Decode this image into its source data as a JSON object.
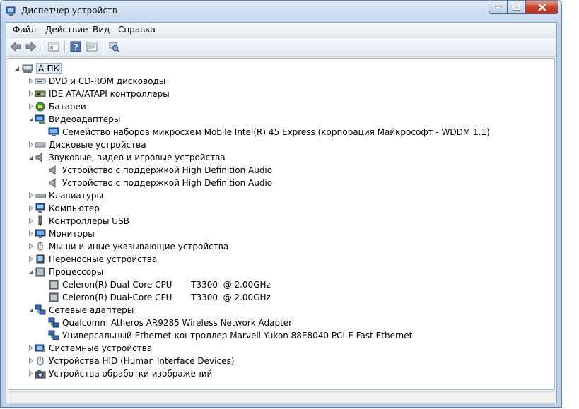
{
  "window": {
    "title": "Диспетчер устройств"
  },
  "menu": [
    "Файл",
    "Действие",
    "Вид",
    "Справка"
  ],
  "toolbar": {
    "buttons": [
      "back-icon",
      "forward-icon",
      "show-hide-tree-icon",
      "help-icon",
      "properties-icon",
      "scan-hardware-icon"
    ]
  },
  "tree": {
    "root": "А-ПК",
    "categories": [
      {
        "label": "DVD и CD-ROM дисководы",
        "icon": "dvd-drive-icon",
        "expanded": false,
        "children": []
      },
      {
        "label": "IDE ATA/ATAPI контроллеры",
        "icon": "ide-controller-icon",
        "expanded": false,
        "children": []
      },
      {
        "label": "Батареи",
        "icon": "battery-icon",
        "expanded": false,
        "children": []
      },
      {
        "label": "Видеоадаптеры",
        "icon": "display-adapter-icon",
        "expanded": true,
        "children": [
          "Семейство наборов микросхем Mobile Intel(R) 45 Express (корпорация Майкрософт - WDDM 1.1)"
        ]
      },
      {
        "label": "Дисковые устройства",
        "icon": "disk-drive-icon",
        "expanded": false,
        "children": []
      },
      {
        "label": "Звуковые, видео и игровые устройства",
        "icon": "speaker-icon",
        "expanded": true,
        "children": [
          "Устройство с поддержкой High Definition Audio",
          "Устройство с поддержкой High Definition Audio"
        ]
      },
      {
        "label": "Клавиатуры",
        "icon": "keyboard-icon",
        "expanded": false,
        "children": []
      },
      {
        "label": "Компьютер",
        "icon": "computer-icon",
        "expanded": false,
        "children": []
      },
      {
        "label": "Контроллеры USB",
        "icon": "usb-icon",
        "expanded": false,
        "children": []
      },
      {
        "label": "Мониторы",
        "icon": "monitor-icon",
        "expanded": false,
        "children": []
      },
      {
        "label": "Мыши и иные указывающие устройства",
        "icon": "mouse-icon",
        "expanded": false,
        "children": []
      },
      {
        "label": "Переносные устройства",
        "icon": "portable-device-icon",
        "expanded": false,
        "children": []
      },
      {
        "label": "Процессоры",
        "icon": "processor-icon",
        "expanded": true,
        "children": [
          "Celeron(R) Dual-Core CPU       T3300  @ 2.00GHz",
          "Celeron(R) Dual-Core CPU       T3300  @ 2.00GHz"
        ]
      },
      {
        "label": "Сетевые адаптеры",
        "icon": "network-adapter-icon",
        "expanded": true,
        "children": [
          "Qualcomm Atheros AR9285 Wireless Network Adapter",
          "Универсальный Ethernet-контроллер Marvell Yukon 88E8040 PCI-E Fast Ethernet"
        ]
      },
      {
        "label": "Системные устройства",
        "icon": "system-device-icon",
        "expanded": false,
        "children": []
      },
      {
        "label": "Устройства HID (Human Interface Devices)",
        "icon": "hid-icon",
        "expanded": false,
        "children": []
      },
      {
        "label": "Устройства обработки изображений",
        "icon": "imaging-device-icon",
        "expanded": false,
        "children": []
      }
    ]
  }
}
